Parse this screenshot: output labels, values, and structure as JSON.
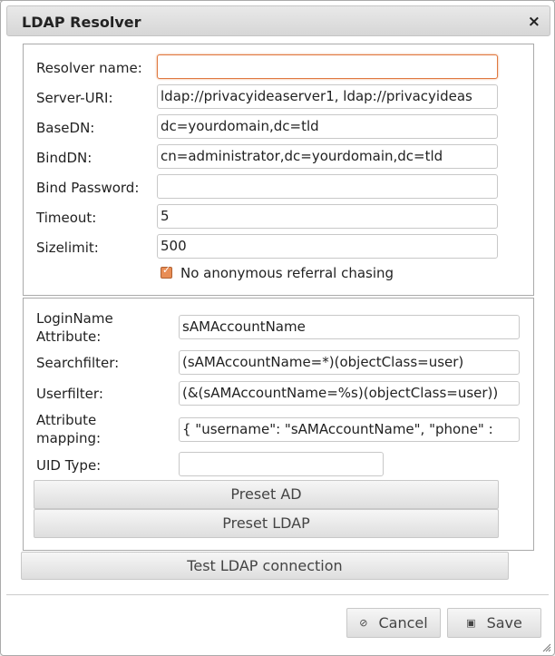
{
  "dialog": {
    "title": "LDAP Resolver",
    "close_glyph": "×"
  },
  "connection": {
    "resolver_name": {
      "label": "Resolver name:",
      "value": ""
    },
    "server_uri": {
      "label": "Server-URI:",
      "value": "ldap://privacyideaserver1, ldap://privacyideas"
    },
    "base_dn": {
      "label": "BaseDN:",
      "value": "dc=yourdomain,dc=tld"
    },
    "bind_dn": {
      "label": "BindDN:",
      "value": "cn=administrator,dc=yourdomain,dc=tld"
    },
    "bind_password": {
      "label": "Bind Password:",
      "value": ""
    },
    "timeout": {
      "label": "Timeout:",
      "value": "5"
    },
    "sizelimit": {
      "label": "Sizelimit:",
      "value": "500"
    },
    "no_referral": {
      "label": "No anonymous referral chasing",
      "checked": true
    }
  },
  "attributes": {
    "login_name_line1": "LoginName",
    "login_name_line2": "Attribute:",
    "login_name_value": "sAMAccountName",
    "searchfilter_label": "Searchfilter:",
    "searchfilter_value": "(sAMAccountName=*)(objectClass=user)",
    "userfilter_label": "Userfilter:",
    "userfilter_value": "(&(sAMAccountName=%s)(objectClass=user))",
    "mapping_line1": "Attribute",
    "mapping_line2": "mapping:",
    "mapping_value": "{ \"username\": \"sAMAccountName\", \"phone\" :",
    "uid_type_label": "UID Type:",
    "uid_type_value": "",
    "preset_ad": "Preset AD",
    "preset_ldap": "Preset LDAP"
  },
  "test_button": "Test LDAP connection",
  "footer": {
    "cancel": "Cancel",
    "save": "Save",
    "cancel_icon": "cancel-icon",
    "save_icon": "save-icon"
  },
  "colors": {
    "focus_border": "#e07840",
    "checkbox": "#e88d55"
  }
}
